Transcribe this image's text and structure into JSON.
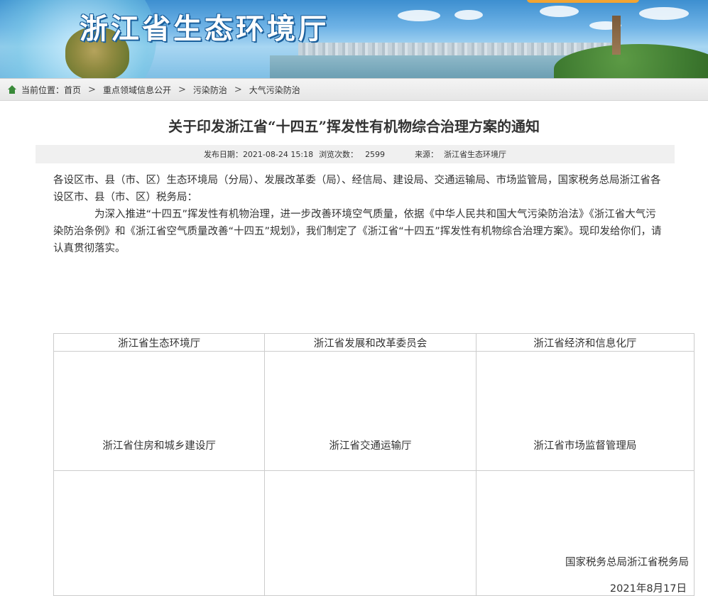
{
  "header": {
    "site_title": "浙江省生态环境厅"
  },
  "breadcrumb": {
    "prefix": "当前位置：",
    "items": [
      "首页",
      "重点领域信息公开",
      "污染防治",
      "大气污染防治"
    ],
    "separator": ">"
  },
  "article": {
    "title": "关于印发浙江省“十四五”挥发性有机物综合治理方案的通知",
    "meta": {
      "publish_label": "发布日期：",
      "publish_date": "2021-08-24 15:18",
      "views_label": "浏览次数：",
      "views": "2599",
      "source_label": "来源：",
      "source": "浙江省生态环境厅"
    },
    "recipients": "各设区市、县（市、区）生态环境局（分局）、发展改革委（局）、经信局、建设局、交通运输局、市场监管局，国家税务总局浙江省各设区市、县（市、区）税务局：",
    "body": "为深入推进“十四五”挥发性有机物治理，进一步改善环境空气质量，依据《中华人民共和国大气污染防治法》《浙江省大气污染防治条例》和《浙江省空气质量改善“十四五”规划》，我们制定了《浙江省“十四五”挥发性有机物综合治理方案》。现印发给你们，请认真贯彻落实。"
  },
  "signatories": {
    "row1": [
      "浙江省生态环境厅",
      "浙江省发展和改革委员会",
      "浙江省经济和信息化厅"
    ],
    "row2": [
      "浙江省住房和城乡建设厅",
      "浙江省交通运输厅",
      "浙江省市场监督管理局"
    ],
    "last": "国家税务总局浙江省税务局",
    "date": "2021年8月17日"
  }
}
